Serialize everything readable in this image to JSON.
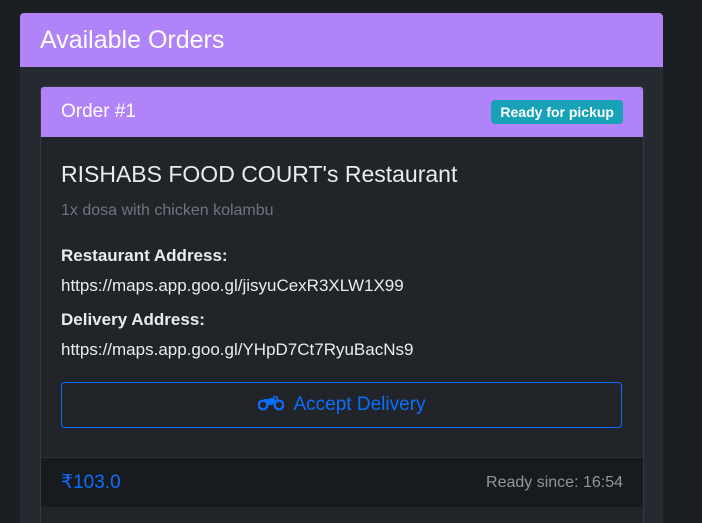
{
  "panel": {
    "title": "Available Orders",
    "accent_color": "#b083f9"
  },
  "order": {
    "number_label": "Order #1",
    "status": "Ready for pickup",
    "restaurant_name": "RISHABS FOOD COURT's Restaurant",
    "items": "1x dosa with chicken kolambu",
    "restaurant_address_label": "Restaurant Address:",
    "restaurant_address": "https://maps.app.goo.gl/jisyuCexR3XLW1X99",
    "delivery_address_label": "Delivery Address:",
    "delivery_address": "https://maps.app.goo.gl/YHpD7Ct7RyuBacNs9",
    "accept_label": "Accept Delivery",
    "accept_icon": "motorcycle-icon",
    "price": "₹103.0",
    "ready_since": "Ready since: 16:54"
  }
}
